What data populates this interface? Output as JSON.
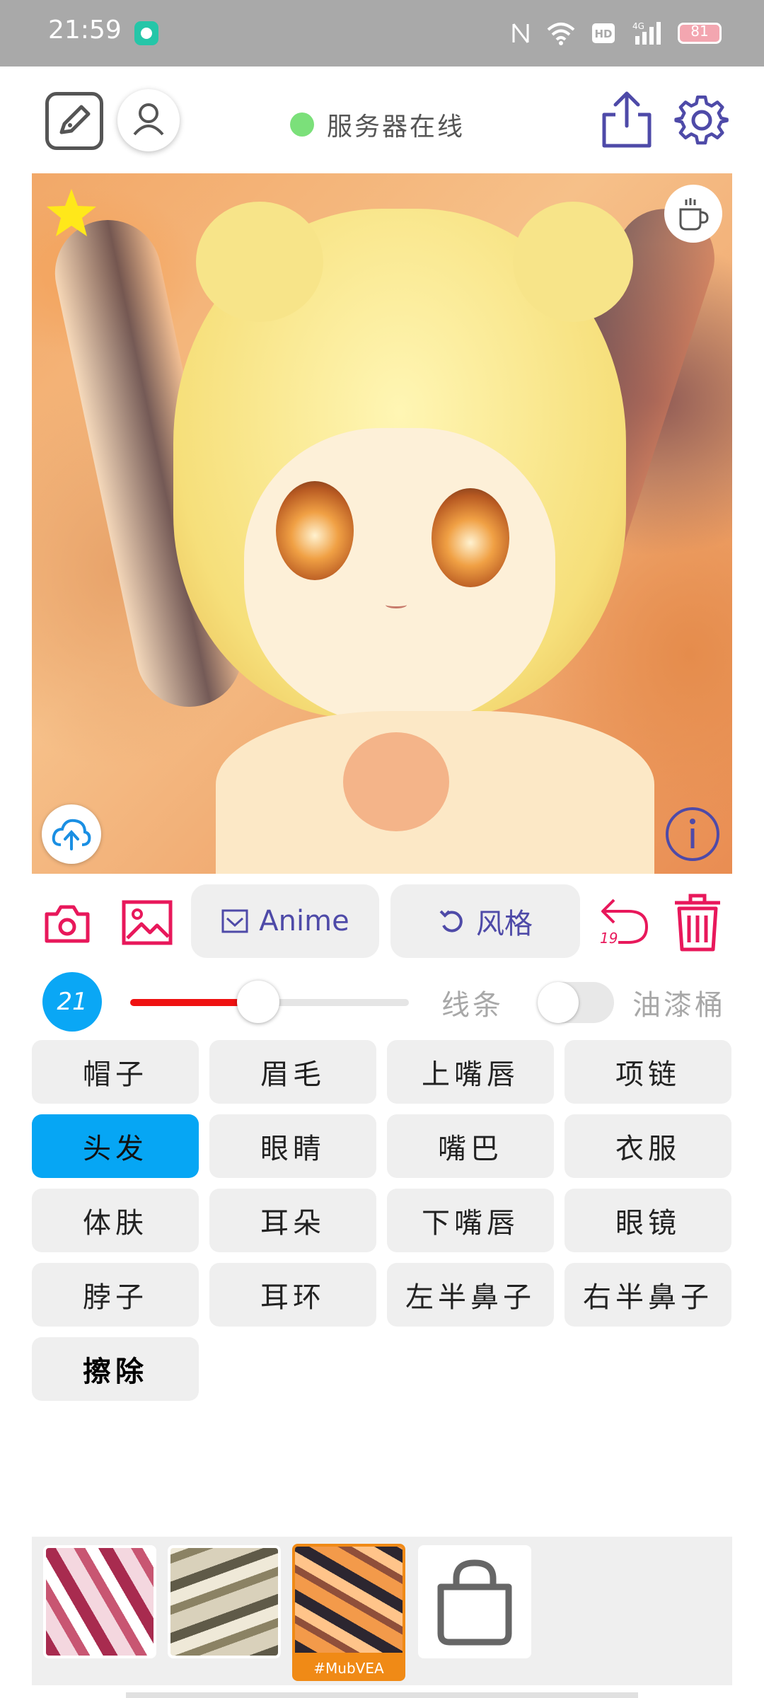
{
  "status_bar": {
    "time": "21:59",
    "battery": "81",
    "network": "4G",
    "hd": "HD"
  },
  "header": {
    "server_status": "服务器在线",
    "server_status_color": "#7be07a",
    "icons": [
      "edit-icon",
      "user-icon",
      "share-icon",
      "gear-icon"
    ]
  },
  "canvas": {
    "overlay_icons": [
      "star-icon",
      "coffee-icon",
      "cloud-upload-icon",
      "info-icon"
    ]
  },
  "toolbar": {
    "anime_label": "Anime",
    "style_label": "风格",
    "undo_count": "19"
  },
  "brush": {
    "size": "21",
    "slider_fraction": 0.46,
    "mode_line": "线条",
    "mode_bucket": "油漆桶",
    "bucket_enabled": false
  },
  "parts": [
    {
      "label": "帽子",
      "active": false
    },
    {
      "label": "眉毛",
      "active": false
    },
    {
      "label": "上嘴唇",
      "active": false
    },
    {
      "label": "项链",
      "active": false
    },
    {
      "label": "头发",
      "active": true
    },
    {
      "label": "眼睛",
      "active": false
    },
    {
      "label": "嘴巴",
      "active": false
    },
    {
      "label": "衣服",
      "active": false
    },
    {
      "label": "体肤",
      "active": false
    },
    {
      "label": "耳朵",
      "active": false
    },
    {
      "label": "下嘴唇",
      "active": false
    },
    {
      "label": "眼镜",
      "active": false
    },
    {
      "label": "脖子",
      "active": false
    },
    {
      "label": "耳环",
      "active": false
    },
    {
      "label": "左半鼻子",
      "active": false
    },
    {
      "label": "右半鼻子",
      "active": false
    },
    {
      "label": "擦除",
      "active": false,
      "bold": true
    }
  ],
  "styles": {
    "selected_tag": "#MubVEA"
  },
  "colors": {
    "accent_blue": "#06a6f4",
    "accent_red": "#e8185b",
    "icon_indigo": "#4e4aa8"
  }
}
